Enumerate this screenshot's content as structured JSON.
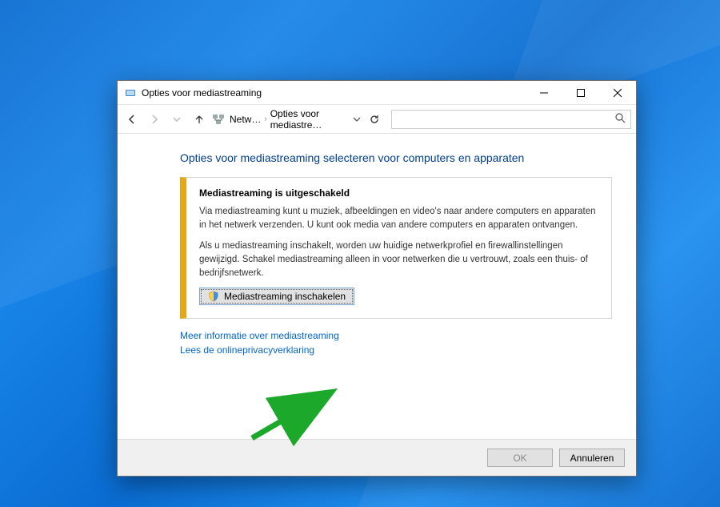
{
  "window": {
    "title": "Opties voor mediastreaming"
  },
  "breadcrumbs": {
    "level1": "Netw…",
    "level2": "Opties voor mediastre…"
  },
  "page": {
    "title": "Opties voor mediastreaming selecteren voor computers en apparaten"
  },
  "panel": {
    "heading": "Mediastreaming is uitgeschakeld",
    "para1": "Via mediastreaming kunt u muziek, afbeeldingen en video's naar andere computers en apparaten in het netwerk verzenden. U kunt ook media van andere computers en apparaten ontvangen.",
    "para2": "Als u mediastreaming inschakelt, worden uw huidige netwerkprofiel en firewallinstellingen gewijzigd. Schakel mediastreaming alleen in voor netwerken die u vertrouwt, zoals een thuis- of bedrijfsnetwerk.",
    "enable_button": "Mediastreaming inschakelen"
  },
  "links": {
    "more_info": "Meer informatie over mediastreaming",
    "privacy": "Lees de onlineprivacyverklaring"
  },
  "footer": {
    "ok": "OK",
    "cancel": "Annuleren"
  }
}
